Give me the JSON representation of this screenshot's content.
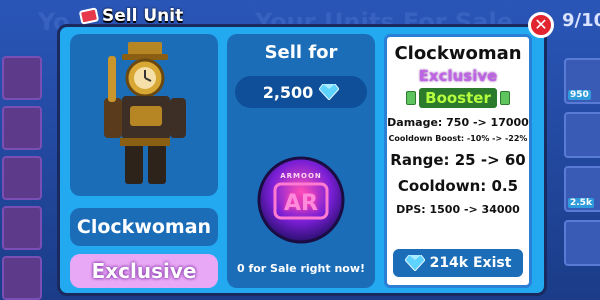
{
  "background": {
    "title_partial_left": "Yo",
    "title_partial_center": "Your Units For Sale",
    "slots_partial": "9/10",
    "side_badges": [
      "950",
      "2.5k"
    ]
  },
  "modal": {
    "tab_label": "Sell Unit",
    "close_label": "✕",
    "unit": {
      "name": "Clockwoman",
      "rarity": "Exclusive",
      "portrait_icon": "clockwoman-avatar"
    },
    "sell": {
      "heading": "Sell for",
      "price": "2,500",
      "currency_icon": "diamond-icon",
      "orb_label": "AR",
      "orb_caption": "ARMOON",
      "status": "0 for Sale right now!"
    },
    "stats": {
      "title": "Clockwoman",
      "rarity": "Exclusive",
      "tag": "Booster",
      "damage": "Damage: 750 -> 17000",
      "cooldown_boost": "Cooldown Boost: -10% -> -22%",
      "range": "Range: 25 -> 60",
      "cooldown": "Cooldown: 0.5",
      "dps": "DPS: 1500 -> 34000",
      "exist": "214k Exist"
    }
  },
  "colors": {
    "panel": "#23a9ef",
    "card": "#1b6db8",
    "close": "#e12430",
    "rarity": "#c064e6",
    "booster": "#2c7a2c"
  }
}
